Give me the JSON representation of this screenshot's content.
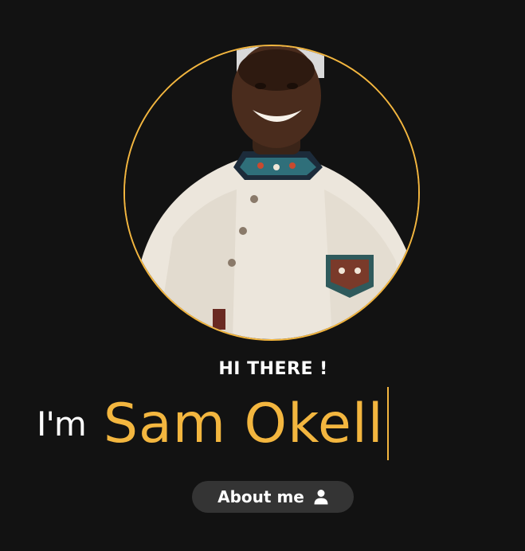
{
  "hero": {
    "greeting": "HI THERE !",
    "intro_prefix": "I'm",
    "name": "Sam Okell",
    "about_button": {
      "label": "About me",
      "icon": "user-icon"
    }
  },
  "colors": {
    "background": "#121212",
    "accent": "#f3b63f",
    "button_bg": "#343434",
    "text": "#ffffff"
  }
}
